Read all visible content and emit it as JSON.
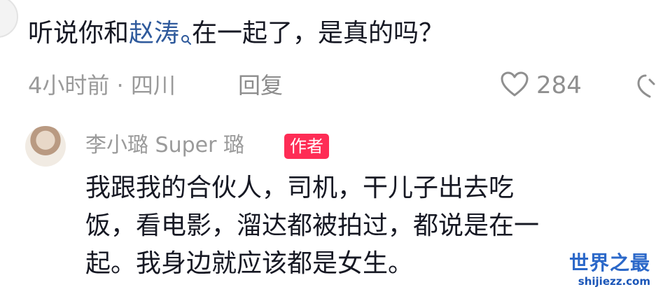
{
  "comment": {
    "text_before": "听说你和",
    "mention": "赵涛",
    "text_after": "在一起了，是真的吗？",
    "time_location": "4小时前 · 四川",
    "reply_label": "回复",
    "like_count": "284"
  },
  "reply": {
    "author": "李小璐 Super 璐",
    "badge": "作者",
    "lines": [
      "我跟我的合伙人，司机，干儿子出去吃",
      "饭，看电影，溜达都被拍过，都说是在一",
      "起。我身边就应该都是女生。"
    ]
  },
  "watermark": {
    "title": "世界之最",
    "url": "shijiezz.com"
  },
  "colors": {
    "mention": "#2f5a9c",
    "badge": "#fe2c55",
    "meta": "#9a9a9a",
    "text": "#161823",
    "watermark": "#2b68c9"
  },
  "icons": [
    "search-icon",
    "heart-icon",
    "dislike-icon"
  ]
}
